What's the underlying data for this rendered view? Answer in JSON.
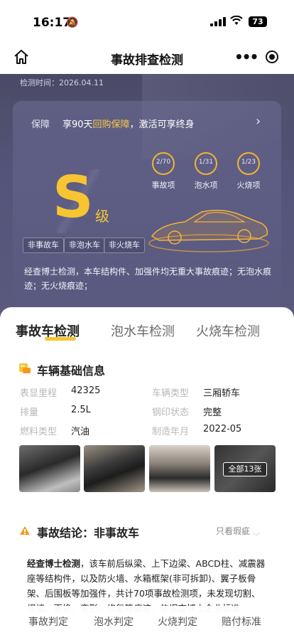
{
  "status": {
    "time": "16:17",
    "battery": "73"
  },
  "nav": {
    "title": "事故排查检测"
  },
  "hero": {
    "detect_time": "检测时间：2026.04.11",
    "guarantee_label": "保障",
    "guarantee_pre": "享90天",
    "guarantee_hl": "回购保障",
    "guarantee_post": "，激活可享终身",
    "grade": "S",
    "grade_suffix": "级",
    "metrics": [
      {
        "value": "2/70",
        "label": "事故项",
        "fraction": 0.0286
      },
      {
        "value": "1/31",
        "label": "泡水项",
        "fraction": 0.0323
      },
      {
        "value": "1/23",
        "label": "火烧项",
        "fraction": 0.0435
      }
    ],
    "tags": [
      "非事故车",
      "非泡水车",
      "非火烧车"
    ],
    "summary": "经查博士检测，本车结构件、加强件均无重大事故痕迹；无泡水痕迹；无火烧痕迹；"
  },
  "tabs": [
    "事故车检测",
    "泡水车检测",
    "火烧车检测"
  ],
  "basic_info": {
    "title": "车辆基础信息",
    "rows": [
      {
        "k1": "表显里程",
        "v1": "42325",
        "k2": "车辆类型",
        "v2": "三厢轿车"
      },
      {
        "k1": "排量",
        "v1": "2.5L",
        "k2": "钢印状态",
        "v2": "完整"
      },
      {
        "k1": "燃料类型",
        "v1": "汽油",
        "k2": "制造年月",
        "v2": "2022-05"
      }
    ],
    "all_photos": "全部13张"
  },
  "conclusion": {
    "title": "事故结论：非事故车",
    "filter": "只看瑕疵",
    "desc_bold": "经查博士检测",
    "desc_rest": "，该车前后纵梁、上下边梁、ABCD柱、减震器座等结构件，以及防火墙、水箱框架(非可拆卸)、翼子板骨架、后围板等加强件，共计70项事故检测项，未发现切割、焊接、更换、变形、修复等痕迹，依据查博士企业标准"
  },
  "bottom_nav": [
    "事故判定",
    "泡水判定",
    "火烧判定",
    "赔付标准"
  ],
  "colors": {
    "accent": "#f7c531",
    "hero_bg": "#54547a"
  }
}
